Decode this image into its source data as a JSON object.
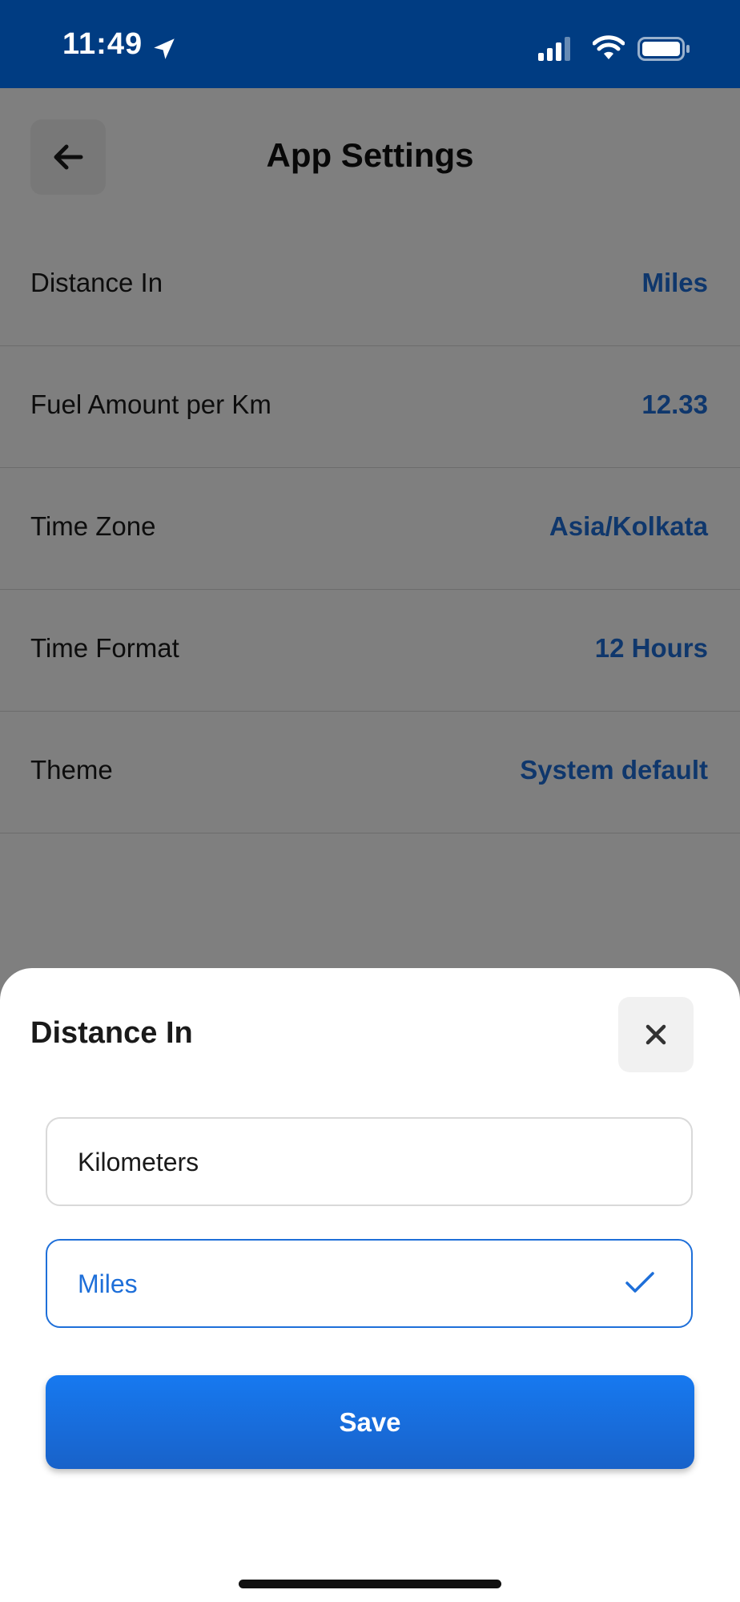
{
  "status_bar": {
    "time": "11:49"
  },
  "header": {
    "title": "App Settings"
  },
  "settings": [
    {
      "label": "Distance In",
      "value": "Miles"
    },
    {
      "label": "Fuel Amount per Km",
      "value": "12.33"
    },
    {
      "label": "Time Zone",
      "value": "Asia/Kolkata"
    },
    {
      "label": "Time Format",
      "value": "12 Hours"
    },
    {
      "label": "Theme",
      "value": "System default"
    }
  ],
  "sheet": {
    "title": "Distance In",
    "options": [
      {
        "label": "Kilometers",
        "selected": false
      },
      {
        "label": "Miles",
        "selected": true
      }
    ],
    "save_label": "Save"
  },
  "colors": {
    "status_bar": "#003C82",
    "accent": "#1E6FD9"
  }
}
